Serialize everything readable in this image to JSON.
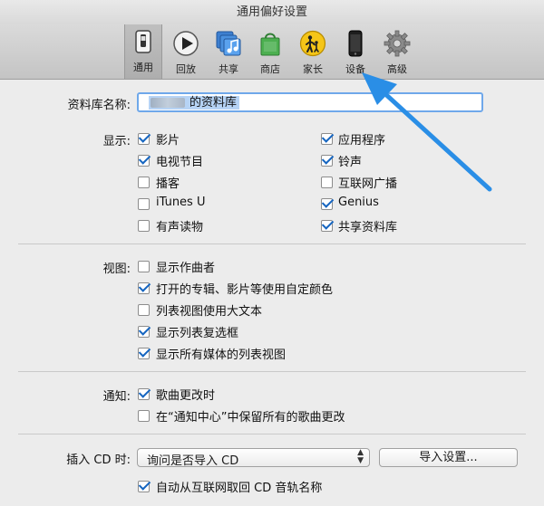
{
  "window": {
    "title": "通用偏好设置"
  },
  "toolbar": {
    "items": [
      {
        "label": "通用",
        "icon": "general-switch-icon",
        "active": true
      },
      {
        "label": "回放",
        "icon": "play-icon"
      },
      {
        "label": "共享",
        "icon": "shared-music-icon"
      },
      {
        "label": "商店",
        "icon": "shopping-bag-icon"
      },
      {
        "label": "家长",
        "icon": "parental-icon"
      },
      {
        "label": "设备",
        "icon": "iphone-icon"
      },
      {
        "label": "高级",
        "icon": "gear-icon"
      }
    ]
  },
  "library": {
    "label": "资料库名称:",
    "name": "的资料库"
  },
  "show": {
    "label": "显示:",
    "left": [
      {
        "text": "影片",
        "checked": true
      },
      {
        "text": "电视节目",
        "checked": true
      },
      {
        "text": "播客",
        "checked": false
      },
      {
        "text": "iTunes U",
        "checked": false
      },
      {
        "text": "有声读物",
        "checked": false
      }
    ],
    "right": [
      {
        "text": "应用程序",
        "checked": true
      },
      {
        "text": "铃声",
        "checked": true
      },
      {
        "text": "互联网广播",
        "checked": false
      },
      {
        "text": "Genius",
        "checked": true
      },
      {
        "text": "共享资料库",
        "checked": true
      }
    ]
  },
  "views": {
    "label": "视图:",
    "options": [
      {
        "text": "显示作曲者",
        "checked": false
      },
      {
        "text": "打开的专辑、影片等使用自定颜色",
        "checked": true
      },
      {
        "text": "列表视图使用大文本",
        "checked": false
      },
      {
        "text": "显示列表复选框",
        "checked": true
      },
      {
        "text": "显示所有媒体的列表视图",
        "checked": true
      }
    ]
  },
  "notify": {
    "label": "通知:",
    "options": [
      {
        "text": "歌曲更改时",
        "checked": true
      },
      {
        "text": "在“通知中心”中保留所有的歌曲更改",
        "checked": false
      }
    ]
  },
  "cd": {
    "label": "插入 CD 时:",
    "popup_value": "询问是否导入 CD",
    "import_button": "导入设置...",
    "auto_option": {
      "text": "自动从互联网取回 CD 音轨名称",
      "checked": true
    }
  },
  "colors": {
    "accent": "#1565c0",
    "annotation_arrow": "#2a8ee6"
  }
}
